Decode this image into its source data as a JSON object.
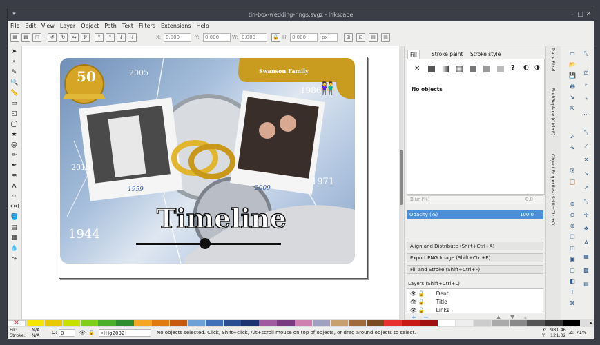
{
  "window": {
    "title": "tin-box-wedding-rings.svgz - Inkscape"
  },
  "menu": [
    "File",
    "Edit",
    "View",
    "Layer",
    "Object",
    "Path",
    "Text",
    "Filters",
    "Extensions",
    "Help"
  ],
  "toolbar": {
    "x_label": "X:",
    "x_value": "0.000",
    "y_label": "Y:",
    "y_value": "0.000",
    "w_label": "W:",
    "w_value": "0.000",
    "h_label": "H:",
    "h_value": "0.000",
    "units": "px"
  },
  "artwork": {
    "badge_number": "50",
    "header_text": "Swanson Family",
    "year_1959": "1959",
    "year_2009": "2009",
    "year_1944": "1944",
    "year_2013": "2013",
    "year_1971": "1971",
    "year_2005": "2005",
    "year_1986": "1986",
    "timeline_title": "Timeline"
  },
  "fill_stroke": {
    "tabs": [
      "Fill",
      "Stroke paint",
      "Stroke style"
    ],
    "no_objects": "No objects",
    "blur_label": "Blur (%)",
    "blur_value": "0.0",
    "opacity_label": "Opacity (%)",
    "opacity_value": "100.0"
  },
  "dock_sections": [
    "Align and Distribute (Shift+Ctrl+A)",
    "Export PNG Image (Shift+Ctrl+E)",
    "Fill and Stroke (Shift+Ctrl+F)"
  ],
  "layers": {
    "title": "Layers (Shift+Ctrl+L)",
    "items": [
      "Dent",
      "Title",
      "Links"
    ]
  },
  "side_tabs": [
    "Trace Pixel",
    "Find/Replace (Ctrl+F)",
    "Object Properties (Shift+Ctrl+O)"
  ],
  "status": {
    "fill_label": "Fill:",
    "fill_value": "N/A",
    "stroke_label": "Stroke:",
    "stroke_value": "N/A",
    "opacity_label": "O:",
    "opacity_value": "0",
    "layer": "•[Hg2032]",
    "message": "No objects selected. Click, Shift+click, Alt+scroll mouse on top of objects, or drag around objects to select.",
    "x_label": "X:",
    "x_value": "981.46",
    "y_label": "Y:",
    "y_value": "121.02",
    "z_label": "Z:",
    "zoom": "71%"
  },
  "palette": [
    "#f5e500",
    "#e8c800",
    "#c8e000",
    "#7fcf1a",
    "#4caf2a",
    "#2e8b2e",
    "#f5a623",
    "#e07b10",
    "#c85a10",
    "#6fa0d8",
    "#3f70b8",
    "#2a4f90",
    "#1c3570",
    "#a05aa0",
    "#7a3a80",
    "#d080b0",
    "#a0a0c0",
    "#c8a070",
    "#a06a3a",
    "#7a4a20",
    "#e83030",
    "#c81818",
    "#a01010",
    "#ffffff",
    "#eeeeee",
    "#cccccc",
    "#aaaaaa",
    "#888888",
    "#555555",
    "#333333",
    "#000000"
  ]
}
